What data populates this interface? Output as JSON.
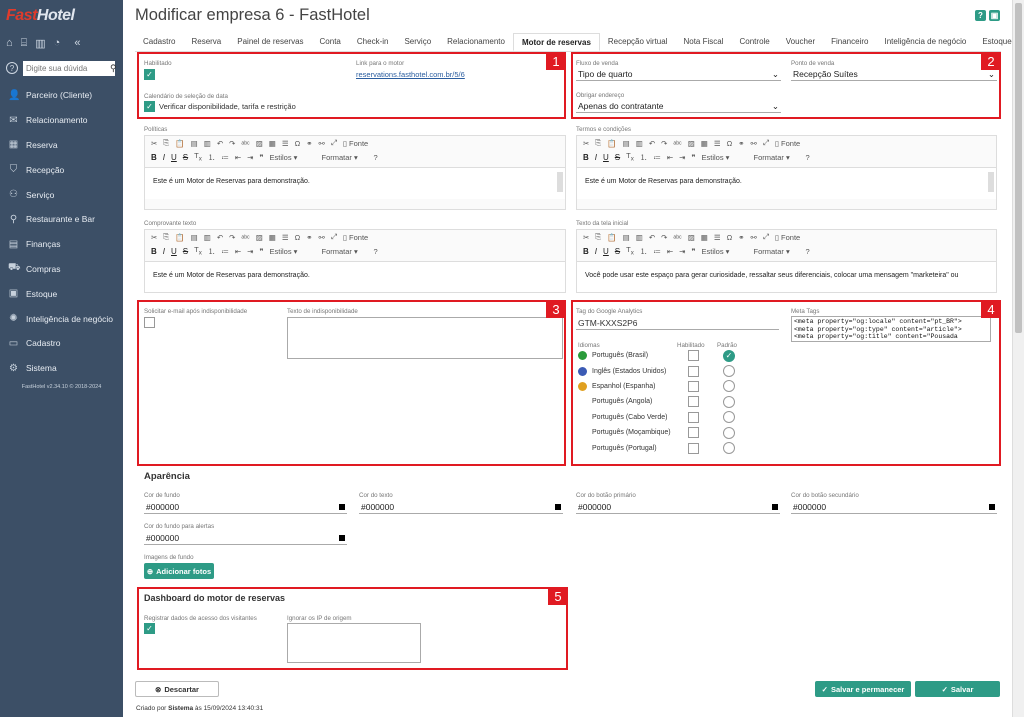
{
  "app": {
    "logo_a": "Fast",
    "logo_b": "Hotel",
    "version": "FastHotel v2.34.10 © 2018-2024"
  },
  "sidebar": {
    "search_placeholder": "Digite sua dúvida",
    "items": [
      {
        "label": "Parceiro (Cliente)",
        "icon": "user-icon"
      },
      {
        "label": "Relacionamento",
        "icon": "chat-icon"
      },
      {
        "label": "Reserva",
        "icon": "calendar-icon"
      },
      {
        "label": "Recepção",
        "icon": "bell-icon"
      },
      {
        "label": "Serviço",
        "icon": "service-icon"
      },
      {
        "label": "Restaurante e Bar",
        "icon": "utensils-icon"
      },
      {
        "label": "Finanças",
        "icon": "chart-icon"
      },
      {
        "label": "Compras",
        "icon": "cart-icon"
      },
      {
        "label": "Estoque",
        "icon": "box-icon"
      },
      {
        "label": "Inteligência de negócio",
        "icon": "bulb-icon"
      },
      {
        "label": "Cadastro",
        "icon": "folder-icon"
      },
      {
        "label": "Sistema",
        "icon": "gear-icon"
      }
    ]
  },
  "page": {
    "title": "Modificar empresa 6 - FastHotel",
    "help": "?",
    "lock": "🔒"
  },
  "tabs": [
    "Cadastro",
    "Reserva",
    "Painel de reservas",
    "Conta",
    "Check-in",
    "Serviço",
    "Relacionamento",
    "Motor de reservas",
    "Recepção virtual",
    "Nota Fiscal",
    "Controle",
    "Voucher",
    "Financeiro",
    "Inteligência de negócio",
    "Estoque"
  ],
  "badges": [
    "1",
    "2",
    "3",
    "4",
    "5"
  ],
  "s1": {
    "habilitado": "Habilitado",
    "link_label": "Link para o motor",
    "link": "reservations.fasthotel.com.br/5/6",
    "cal_label": "Calendário de seleção de data",
    "cal_option": "Verificar disponibilidade, tarifa e restrição"
  },
  "s2": {
    "fluxo_label": "Fluxo de venda",
    "fluxo_value": "Tipo de quarto",
    "ponto_label": "Ponto de venda",
    "ponto_value": "Recepção Suítes",
    "obrigar_label": "Obrigar endereço",
    "obrigar_value": "Apenas do contratante"
  },
  "editors": {
    "politicas": {
      "label": "Políticas",
      "text": "Este é um Motor de Reservas para demonstração."
    },
    "termos": {
      "label": "Termos e condições",
      "text": "Este é um Motor de Reservas para demonstração."
    },
    "comprovante": {
      "label": "Comprovante texto",
      "text": "Este é um Motor de Reservas para demonstração."
    },
    "tela": {
      "label": "Texto da tela inicial",
      "text": "Você pode usar este espaço para gerar curiosidade, ressaltar seus diferenciais, colocar uma mensagem \"marketeira\" ou"
    }
  },
  "toolbar": {
    "fonte": "Fonte",
    "estilos": "Estilos",
    "formatar": "Formatar"
  },
  "s3": {
    "solicitar": "Solicitar e-mail após indisponibilidade",
    "texto": "Texto de indisponibilidade"
  },
  "s4": {
    "ga_label": "Tag do Google Analytics",
    "ga_value": "GTM-KXXS2P6",
    "meta_label": "Meta Tags",
    "meta": "<meta property=\"og:locale\" content=\"pt_BR\">\n<meta property=\"og:type\" content=\"article\">\n<meta property=\"og:title\" content=\"Pousada",
    "idiomas": "Idiomas",
    "habilitado": "Habilitado",
    "padrao": "Padrão",
    "langs": [
      {
        "name": "Português (Brasil)",
        "flag": "#2a9b3a",
        "checked": false,
        "default": true
      },
      {
        "name": "Inglês (Estados Unidos)",
        "flag": "#3b5bb5",
        "checked": false,
        "default": false
      },
      {
        "name": "Espanhol (Espanha)",
        "flag": "#e0a020",
        "checked": false,
        "default": false
      },
      {
        "name": "Português (Angola)",
        "flag": "",
        "checked": false,
        "default": false
      },
      {
        "name": "Português (Cabo Verde)",
        "flag": "",
        "checked": false,
        "default": false
      },
      {
        "name": "Português (Moçambique)",
        "flag": "",
        "checked": false,
        "default": false
      },
      {
        "name": "Português (Portugal)",
        "flag": "",
        "checked": false,
        "default": false
      }
    ]
  },
  "aparencia": {
    "title": "Aparência",
    "fundo_label": "Cor de fundo",
    "fundo": "#000000",
    "texto_label": "Cor do texto",
    "texto": "#000000",
    "primario_label": "Cor do botão primário",
    "primario": "#000000",
    "secundario_label": "Cor do botão secundário",
    "secundario": "#000000",
    "alertas_label": "Cor do fundo para alertas",
    "alertas": "#000000",
    "imagens_label": "Imagens de fundo",
    "add_fotos": "Adicionar fotos"
  },
  "s5": {
    "title": "Dashboard do motor de reservas",
    "registrar": "Registrar dados de acesso dos visitantes",
    "ignorar": "Ignorar os IP de origem"
  },
  "footer": {
    "descartar": "Descartar",
    "salvar_perm": "Salvar e permanecer",
    "salvar": "Salvar",
    "criado_prefix": "Criado por ",
    "criado_user": "Sistema",
    "criado_suffix": " às 15/09/2024 13:40:31"
  }
}
